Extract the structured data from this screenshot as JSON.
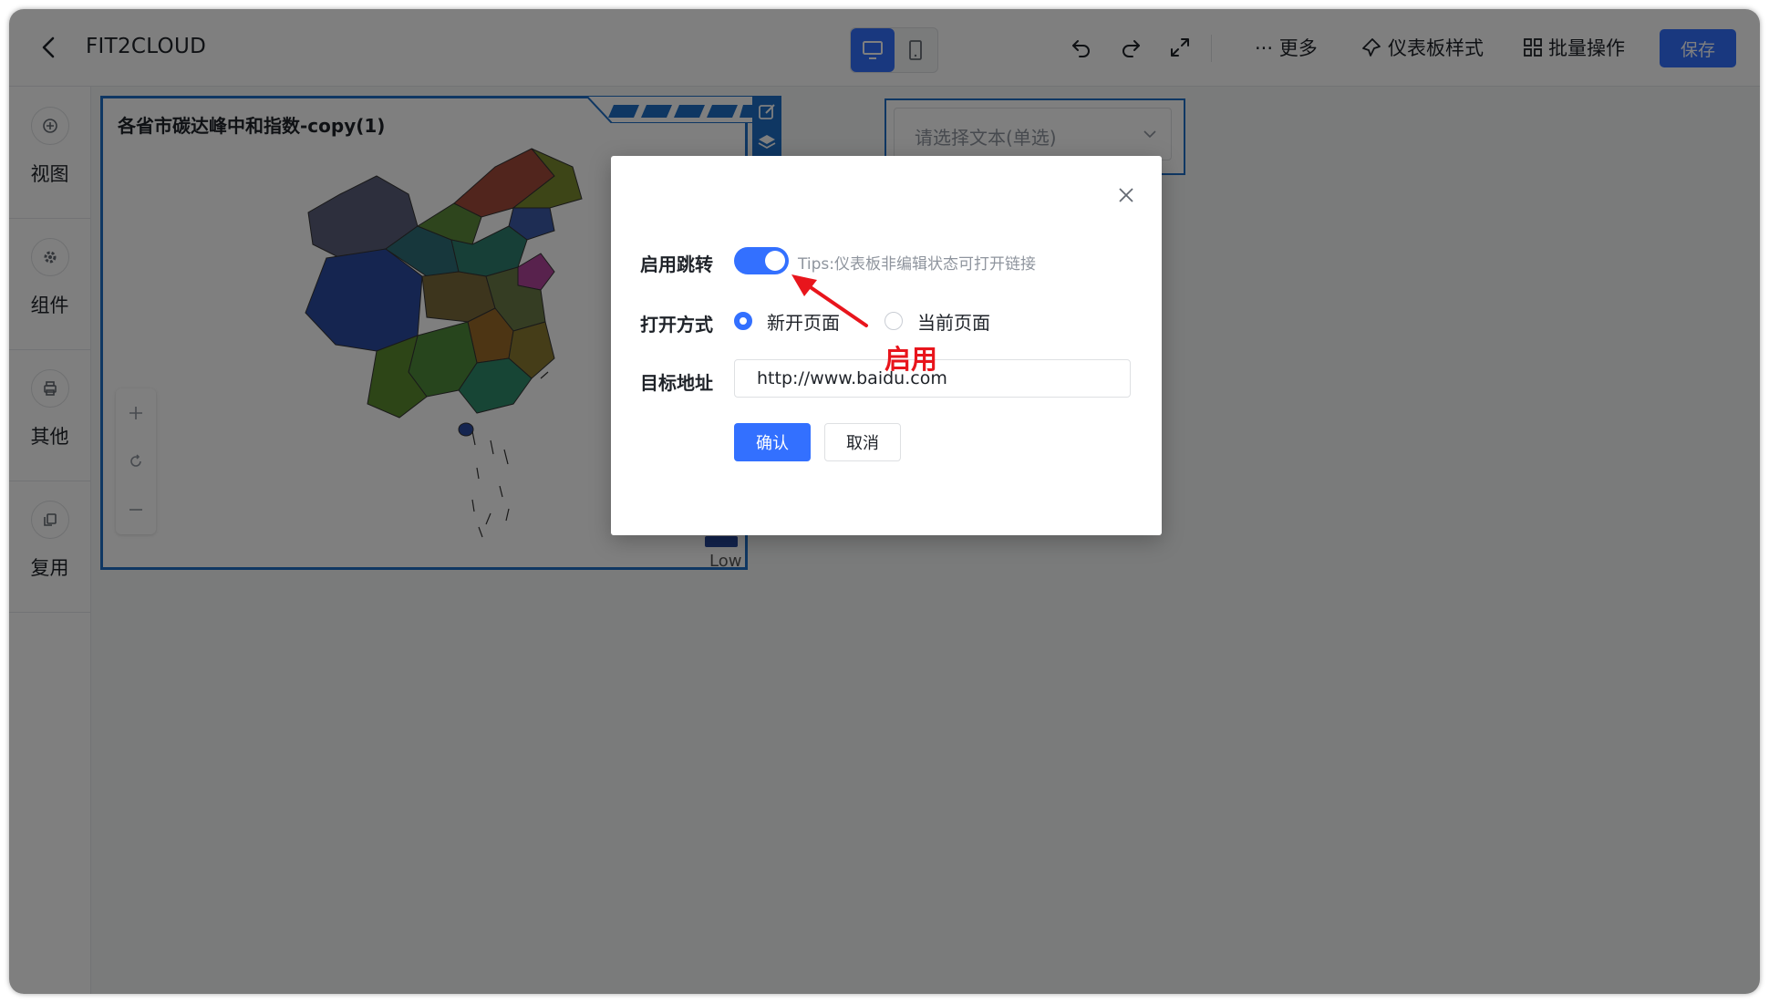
{
  "header": {
    "app_title": "FIT2CLOUD",
    "more_label": "··· 更多",
    "dashboard_style_label": "仪表板样式",
    "batch_label": "批量操作",
    "save_label": "保存"
  },
  "rail": {
    "items": [
      {
        "label": "视图",
        "icon": "plus-circle-icon"
      },
      {
        "label": "组件",
        "icon": "gear-icon"
      },
      {
        "label": "其他",
        "icon": "printer-icon"
      },
      {
        "label": "复用",
        "icon": "copy-icon"
      }
    ]
  },
  "canvas": {
    "map_title": "各省市碳达峰中和指数-copy(1)",
    "legend_low": "Low",
    "select_placeholder": "请选择文本(单选)"
  },
  "modal": {
    "enable_jump_label": "启用跳转",
    "enable_jump_on": true,
    "tips": "Tips:仪表板非编辑状态可打开链接",
    "open_mode_label": "打开方式",
    "open_mode_options": [
      "新开页面",
      "当前页面"
    ],
    "open_mode_selected": "新开页面",
    "target_label": "目标地址",
    "target_url": "http://www.baidu.com",
    "confirm_label": "确认",
    "cancel_label": "取消",
    "annotation": "启用"
  },
  "colors": {
    "accent": "#3370ff",
    "annotation": "#e8151c",
    "card_border": "#1e6ec6"
  }
}
